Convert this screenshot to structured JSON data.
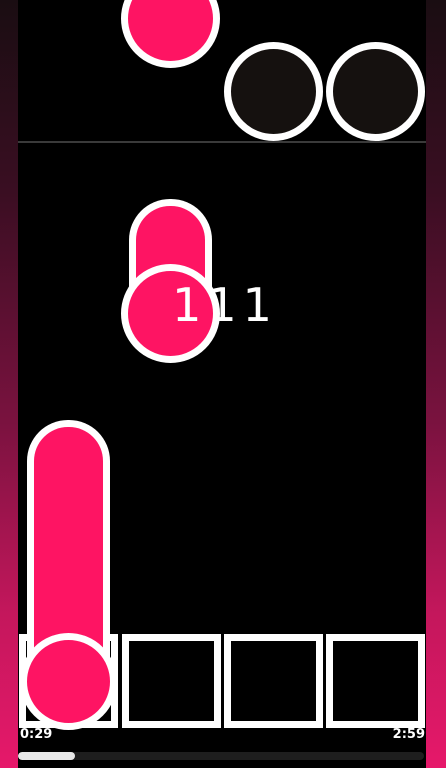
{
  "hud": {
    "combo": "111",
    "elapsed_time": "0:29",
    "total_time": "2:59",
    "progress_fraction": 0.14
  },
  "colors": {
    "note_accent": "#fe1463",
    "note_dark": "#15110f",
    "outline": "#ffffff",
    "background": "#000000"
  },
  "lanes": {
    "count": 4,
    "receptors": [
      "lane-1",
      "lane-2",
      "lane-3",
      "lane-4"
    ]
  }
}
